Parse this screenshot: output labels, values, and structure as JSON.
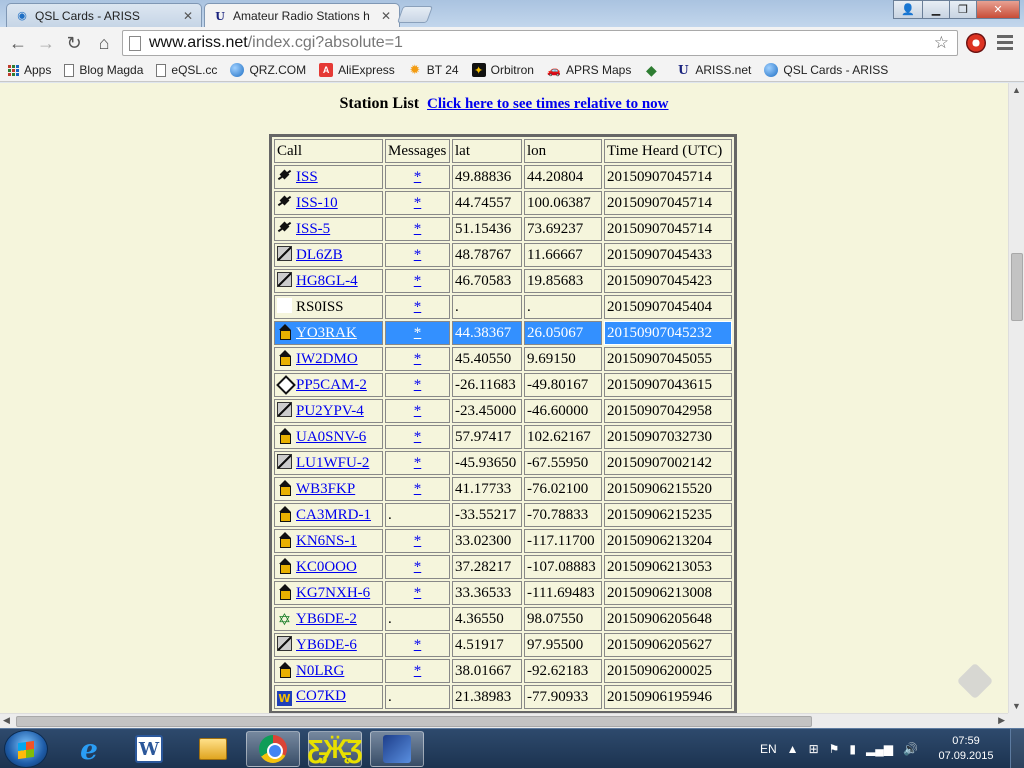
{
  "tabs": [
    {
      "title": "QSL Cards - ARISS",
      "favicon": "ariss-favicon",
      "active": false
    },
    {
      "title": "Amateur Radio Stations h",
      "favicon": "ariss-u-favicon",
      "active": true
    }
  ],
  "toolbar": {
    "url_host": "www.ariss.net",
    "url_path": "/index.cgi?absolute=1"
  },
  "bookmarks": [
    {
      "label": "Apps",
      "icon": "apps-grid-icon"
    },
    {
      "label": "Blog Magda",
      "icon": "page-icon"
    },
    {
      "label": "eQSL.cc",
      "icon": "page-icon"
    },
    {
      "label": "QRZ.COM",
      "icon": "globe-icon"
    },
    {
      "label": "AliExpress",
      "icon": "aliexpress-icon"
    },
    {
      "label": "BT 24",
      "icon": "bt24-icon"
    },
    {
      "label": "Orbitron",
      "icon": "orbitron-icon"
    },
    {
      "label": "APRS Maps",
      "icon": "car-icon"
    },
    {
      "label": "",
      "icon": "diamond-icon"
    },
    {
      "label": "ARISS.net",
      "icon": "ariss-u-icon"
    },
    {
      "label": "QSL Cards - ARISS",
      "icon": "globe-icon"
    }
  ],
  "page": {
    "heading": "Station List",
    "relative_link": "Click here to see times relative to now",
    "columns": [
      "Call",
      "Messages",
      "lat",
      "lon",
      "Time Heard (UTC)"
    ],
    "rows": [
      {
        "symbol": "satellite",
        "call": "ISS",
        "msg": "*",
        "lat": "49.88836",
        "lon": "44.20804",
        "time": "20150907045714",
        "linked": true
      },
      {
        "symbol": "satellite",
        "call": "ISS-10",
        "msg": "*",
        "lat": "44.74557",
        "lon": "100.06387",
        "time": "20150907045714",
        "linked": true
      },
      {
        "symbol": "satellite",
        "call": "ISS-5",
        "msg": "*",
        "lat": "51.15436",
        "lon": "73.69237",
        "time": "20150907045714",
        "linked": true
      },
      {
        "symbol": "dish",
        "call": "DL6ZB",
        "msg": "*",
        "lat": "48.78767",
        "lon": "11.66667",
        "time": "20150907045433",
        "linked": true
      },
      {
        "symbol": "dish",
        "call": "HG8GL-4",
        "msg": "*",
        "lat": "46.70583",
        "lon": "19.85683",
        "time": "20150907045423",
        "linked": true
      },
      {
        "symbol": "blank",
        "call": "RS0ISS",
        "msg": "*",
        "lat": ".",
        "lon": ".",
        "time": "20150907045404",
        "linked": false
      },
      {
        "symbol": "house",
        "call": "YO3RAK",
        "msg": "*",
        "lat": "44.38367",
        "lon": "26.05067",
        "time": "20150907045232",
        "linked": true,
        "selected": true
      },
      {
        "symbol": "house",
        "call": "IW2DMO",
        "msg": "*",
        "lat": "45.40550",
        "lon": "9.69150",
        "time": "20150907045055",
        "linked": true
      },
      {
        "symbol": "diamond",
        "call": "PP5CAM-2",
        "msg": "*",
        "lat": "-26.11683",
        "lon": "-49.80167",
        "time": "20150907043615",
        "linked": true
      },
      {
        "symbol": "dish",
        "call": "PU2YPV-4",
        "msg": "*",
        "lat": "-23.45000",
        "lon": "-46.60000",
        "time": "20150907042958",
        "linked": true
      },
      {
        "symbol": "house",
        "call": "UA0SNV-6",
        "msg": "*",
        "lat": "57.97417",
        "lon": "102.62167",
        "time": "20150907032730",
        "linked": true
      },
      {
        "symbol": "dish",
        "call": "LU1WFU-2",
        "msg": "*",
        "lat": "-45.93650",
        "lon": "-67.55950",
        "time": "20150907002142",
        "linked": true
      },
      {
        "symbol": "house",
        "call": "WB3FKP",
        "msg": "*",
        "lat": "41.17733",
        "lon": "-76.02100",
        "time": "20150906215520",
        "linked": true
      },
      {
        "symbol": "house",
        "call": "CA3MRD-1",
        "msg": ".",
        "lat": "-33.55217",
        "lon": "-70.78833",
        "time": "20150906215235",
        "linked": true
      },
      {
        "symbol": "house",
        "call": "KN6NS-1",
        "msg": "*",
        "lat": "33.02300",
        "lon": "-117.11700",
        "time": "20150906213204",
        "linked": true
      },
      {
        "symbol": "house",
        "call": "KC0OOO",
        "msg": "*",
        "lat": "37.28217",
        "lon": "-107.08883",
        "time": "20150906213053",
        "linked": true
      },
      {
        "symbol": "house",
        "call": "KG7NXH-6",
        "msg": "*",
        "lat": "33.36533",
        "lon": "-111.69483",
        "time": "20150906213008",
        "linked": true
      },
      {
        "symbol": "star",
        "call": "YB6DE-2",
        "msg": ".",
        "lat": "4.36550",
        "lon": "98.07550",
        "time": "20150906205648",
        "linked": true
      },
      {
        "symbol": "dish",
        "call": "YB6DE-6",
        "msg": "*",
        "lat": "4.51917",
        "lon": "97.95500",
        "time": "20150906205627",
        "linked": true
      },
      {
        "symbol": "house",
        "call": "N0LRG",
        "msg": "*",
        "lat": "38.01667",
        "lon": "-92.62183",
        "time": "20150906200025",
        "linked": true
      },
      {
        "symbol": "flag",
        "call": "CO7KD",
        "msg": ".",
        "lat": "21.38983",
        "lon": "-77.90933",
        "time": "20150906195946",
        "linked": true
      }
    ]
  },
  "taskbar": {
    "language": "EN",
    "time": "07:59",
    "date": "07.09.2015"
  },
  "colors": {
    "page_background": "#f5f5dc",
    "link": "#0000ee",
    "selection": "#3390ff"
  }
}
